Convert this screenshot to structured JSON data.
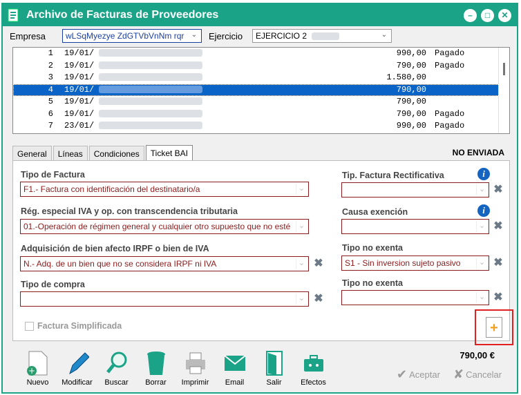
{
  "window": {
    "title": "Archivo de Facturas de Proveedores",
    "controls": [
      "–",
      "□",
      "✕"
    ]
  },
  "header": {
    "empresa_label": "Empresa",
    "empresa_value": "wLSqMyezye ZdGTVbVnNm rqr",
    "ejercicio_label": "Ejercicio",
    "ejercicio_value": "EJERCICIO 2"
  },
  "invoices": [
    {
      "num": "1",
      "date": "19/01/",
      "amount": "990,00",
      "status": "Pagado"
    },
    {
      "num": "2",
      "date": "19/01/",
      "amount": "790,00",
      "status": "Pagado"
    },
    {
      "num": "3",
      "date": "19/01/",
      "amount": "1.580,00",
      "status": ""
    },
    {
      "num": "4",
      "date": "19/01/",
      "amount": "790,00",
      "status": ""
    },
    {
      "num": "5",
      "date": "19/01/",
      "amount": "790,00",
      "status": ""
    },
    {
      "num": "6",
      "date": "19/01/",
      "amount": "790,00",
      "status": "Pagado"
    },
    {
      "num": "7",
      "date": "23/01/",
      "amount": "990,00",
      "status": "Pagado"
    }
  ],
  "selected_row": 3,
  "tabs": [
    {
      "label": "General"
    },
    {
      "label": "Líneas"
    },
    {
      "label": "Condiciones"
    },
    {
      "label": "Ticket BAI"
    }
  ],
  "status_text": "NO ENVIADA",
  "form": {
    "tipo_factura_label": "Tipo de Factura",
    "tipo_factura_value": "F1.- Factura con identificación del destinatario/a",
    "regimen_label": "Rég. especial IVA y op. con transcendencia tributaria",
    "regimen_value": "01.-Operación de régimen general y cualquier otro supuesto que no esté",
    "adquisicion_label": "Adquisición de bien afecto IRPF o bien de IVA",
    "adquisicion_value": "N.- Adq. de un bien que no se considera IRPF ni IVA",
    "tipo_compra_label": "Tipo de compra",
    "tipo_compra_value": "",
    "rectificativa_label": "Tip. Factura Rectificativa",
    "rectificativa_value": "",
    "causa_label": "Causa exención",
    "causa_value": "",
    "no_exenta1_label": "Tipo no exenta",
    "no_exenta1_value": "S1 - Sin inversion sujeto pasivo",
    "no_exenta2_label": "Tipo no exenta",
    "no_exenta2_value": "",
    "simplificada_label": "Factura Simplificada"
  },
  "total": "790,00 €",
  "toolbar": [
    {
      "label": "Nuevo",
      "icon": "new-document-icon"
    },
    {
      "label": "Modificar",
      "icon": "pen-icon"
    },
    {
      "label": "Buscar",
      "icon": "magnifier-icon"
    },
    {
      "label": "Borrar",
      "icon": "trash-icon"
    },
    {
      "label": "Imprimir",
      "icon": "printer-icon"
    },
    {
      "label": "Email",
      "icon": "envelope-icon"
    },
    {
      "label": "Salir",
      "icon": "exit-door-icon"
    },
    {
      "label": "Efectos",
      "icon": "briefcase-icon"
    }
  ],
  "buttons": {
    "aceptar": "Aceptar",
    "cancelar": "Cancelar"
  },
  "colors": {
    "titlebar": "#1aa386",
    "selection": "#0a64c8",
    "field_border": "#8b1a1a",
    "highlight_box": "#e02020"
  }
}
